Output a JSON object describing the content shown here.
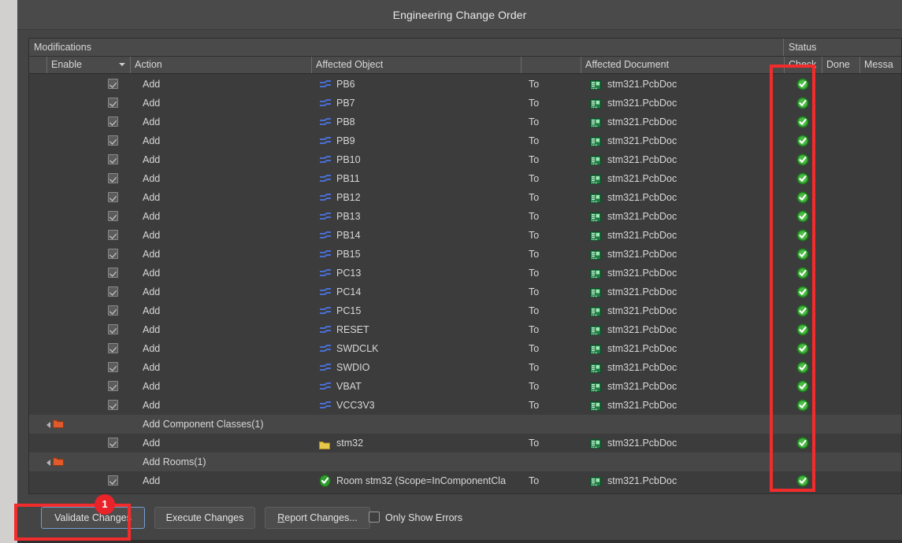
{
  "window": {
    "title": "Engineering Change Order"
  },
  "grid": {
    "captions": {
      "modifications": "Modifications",
      "status": "Status"
    },
    "columns": {
      "enable": "Enable",
      "action": "Action",
      "affected_object": "Affected Object",
      "affected_document": "Affected Document",
      "check": "Check",
      "done": "Done",
      "message": "Messa"
    },
    "rows": [
      {
        "type": "item",
        "enabled": true,
        "action": "Add",
        "object_icon": "net-icon",
        "object": "PB6",
        "to": "To",
        "doc_icon": "pcbdoc-icon",
        "document": "stm321.PcbDoc",
        "check": "ok"
      },
      {
        "type": "item",
        "enabled": true,
        "action": "Add",
        "object_icon": "net-icon",
        "object": "PB7",
        "to": "To",
        "doc_icon": "pcbdoc-icon",
        "document": "stm321.PcbDoc",
        "check": "ok"
      },
      {
        "type": "item",
        "enabled": true,
        "action": "Add",
        "object_icon": "net-icon",
        "object": "PB8",
        "to": "To",
        "doc_icon": "pcbdoc-icon",
        "document": "stm321.PcbDoc",
        "check": "ok"
      },
      {
        "type": "item",
        "enabled": true,
        "action": "Add",
        "object_icon": "net-icon",
        "object": "PB9",
        "to": "To",
        "doc_icon": "pcbdoc-icon",
        "document": "stm321.PcbDoc",
        "check": "ok"
      },
      {
        "type": "item",
        "enabled": true,
        "action": "Add",
        "object_icon": "net-icon",
        "object": "PB10",
        "to": "To",
        "doc_icon": "pcbdoc-icon",
        "document": "stm321.PcbDoc",
        "check": "ok"
      },
      {
        "type": "item",
        "enabled": true,
        "action": "Add",
        "object_icon": "net-icon",
        "object": "PB11",
        "to": "To",
        "doc_icon": "pcbdoc-icon",
        "document": "stm321.PcbDoc",
        "check": "ok"
      },
      {
        "type": "item",
        "enabled": true,
        "action": "Add",
        "object_icon": "net-icon",
        "object": "PB12",
        "to": "To",
        "doc_icon": "pcbdoc-icon",
        "document": "stm321.PcbDoc",
        "check": "ok"
      },
      {
        "type": "item",
        "enabled": true,
        "action": "Add",
        "object_icon": "net-icon",
        "object": "PB13",
        "to": "To",
        "doc_icon": "pcbdoc-icon",
        "document": "stm321.PcbDoc",
        "check": "ok"
      },
      {
        "type": "item",
        "enabled": true,
        "action": "Add",
        "object_icon": "net-icon",
        "object": "PB14",
        "to": "To",
        "doc_icon": "pcbdoc-icon",
        "document": "stm321.PcbDoc",
        "check": "ok"
      },
      {
        "type": "item",
        "enabled": true,
        "action": "Add",
        "object_icon": "net-icon",
        "object": "PB15",
        "to": "To",
        "doc_icon": "pcbdoc-icon",
        "document": "stm321.PcbDoc",
        "check": "ok"
      },
      {
        "type": "item",
        "enabled": true,
        "action": "Add",
        "object_icon": "net-icon",
        "object": "PC13",
        "to": "To",
        "doc_icon": "pcbdoc-icon",
        "document": "stm321.PcbDoc",
        "check": "ok"
      },
      {
        "type": "item",
        "enabled": true,
        "action": "Add",
        "object_icon": "net-icon",
        "object": "PC14",
        "to": "To",
        "doc_icon": "pcbdoc-icon",
        "document": "stm321.PcbDoc",
        "check": "ok"
      },
      {
        "type": "item",
        "enabled": true,
        "action": "Add",
        "object_icon": "net-icon",
        "object": "PC15",
        "to": "To",
        "doc_icon": "pcbdoc-icon",
        "document": "stm321.PcbDoc",
        "check": "ok"
      },
      {
        "type": "item",
        "enabled": true,
        "action": "Add",
        "object_icon": "net-icon",
        "object": "RESET",
        "to": "To",
        "doc_icon": "pcbdoc-icon",
        "document": "stm321.PcbDoc",
        "check": "ok"
      },
      {
        "type": "item",
        "enabled": true,
        "action": "Add",
        "object_icon": "net-icon",
        "object": "SWDCLK",
        "to": "To",
        "doc_icon": "pcbdoc-icon",
        "document": "stm321.PcbDoc",
        "check": "ok"
      },
      {
        "type": "item",
        "enabled": true,
        "action": "Add",
        "object_icon": "net-icon",
        "object": "SWDIO",
        "to": "To",
        "doc_icon": "pcbdoc-icon",
        "document": "stm321.PcbDoc",
        "check": "ok"
      },
      {
        "type": "item",
        "enabled": true,
        "action": "Add",
        "object_icon": "net-icon",
        "object": "VBAT",
        "to": "To",
        "doc_icon": "pcbdoc-icon",
        "document": "stm321.PcbDoc",
        "check": "ok"
      },
      {
        "type": "item",
        "enabled": true,
        "action": "Add",
        "object_icon": "net-icon",
        "object": "VCC3V3",
        "to": "To",
        "doc_icon": "pcbdoc-icon",
        "document": "stm321.PcbDoc",
        "check": "ok"
      },
      {
        "type": "group",
        "action": "Add Component Classes(1)"
      },
      {
        "type": "item",
        "enabled": true,
        "action": "Add",
        "object_icon": "folder-yellow-icon",
        "object": "stm32",
        "to": "To",
        "doc_icon": "pcbdoc-icon",
        "document": "stm321.PcbDoc",
        "check": "ok"
      },
      {
        "type": "group",
        "action": "Add Rooms(1)"
      },
      {
        "type": "item",
        "enabled": true,
        "action": "Add",
        "object_icon": "room-icon",
        "object": "Room stm32 (Scope=InComponentCla",
        "to": "To",
        "doc_icon": "pcbdoc-icon",
        "document": "stm321.PcbDoc",
        "check": "ok"
      }
    ]
  },
  "footer": {
    "validate_label": "Validate Changes",
    "execute_label": "Execute Changes",
    "report_label_prefix": "R",
    "report_label_rest": "eport Changes...",
    "only_show_errors_label": "Only Show Errors",
    "only_show_errors_checked": false
  },
  "annotations": {
    "badge_1": "1"
  },
  "colors": {
    "accent_red": "#f22c2c",
    "badge_red": "#e8232a",
    "net_blue": "#4a6fd4",
    "ok_green": "#35a035",
    "folder_orange": "#e05a2b",
    "folder_yellow": "#e8c84a",
    "panel_bg": "#3c3c3c",
    "header_bg": "#4a4a4a"
  }
}
